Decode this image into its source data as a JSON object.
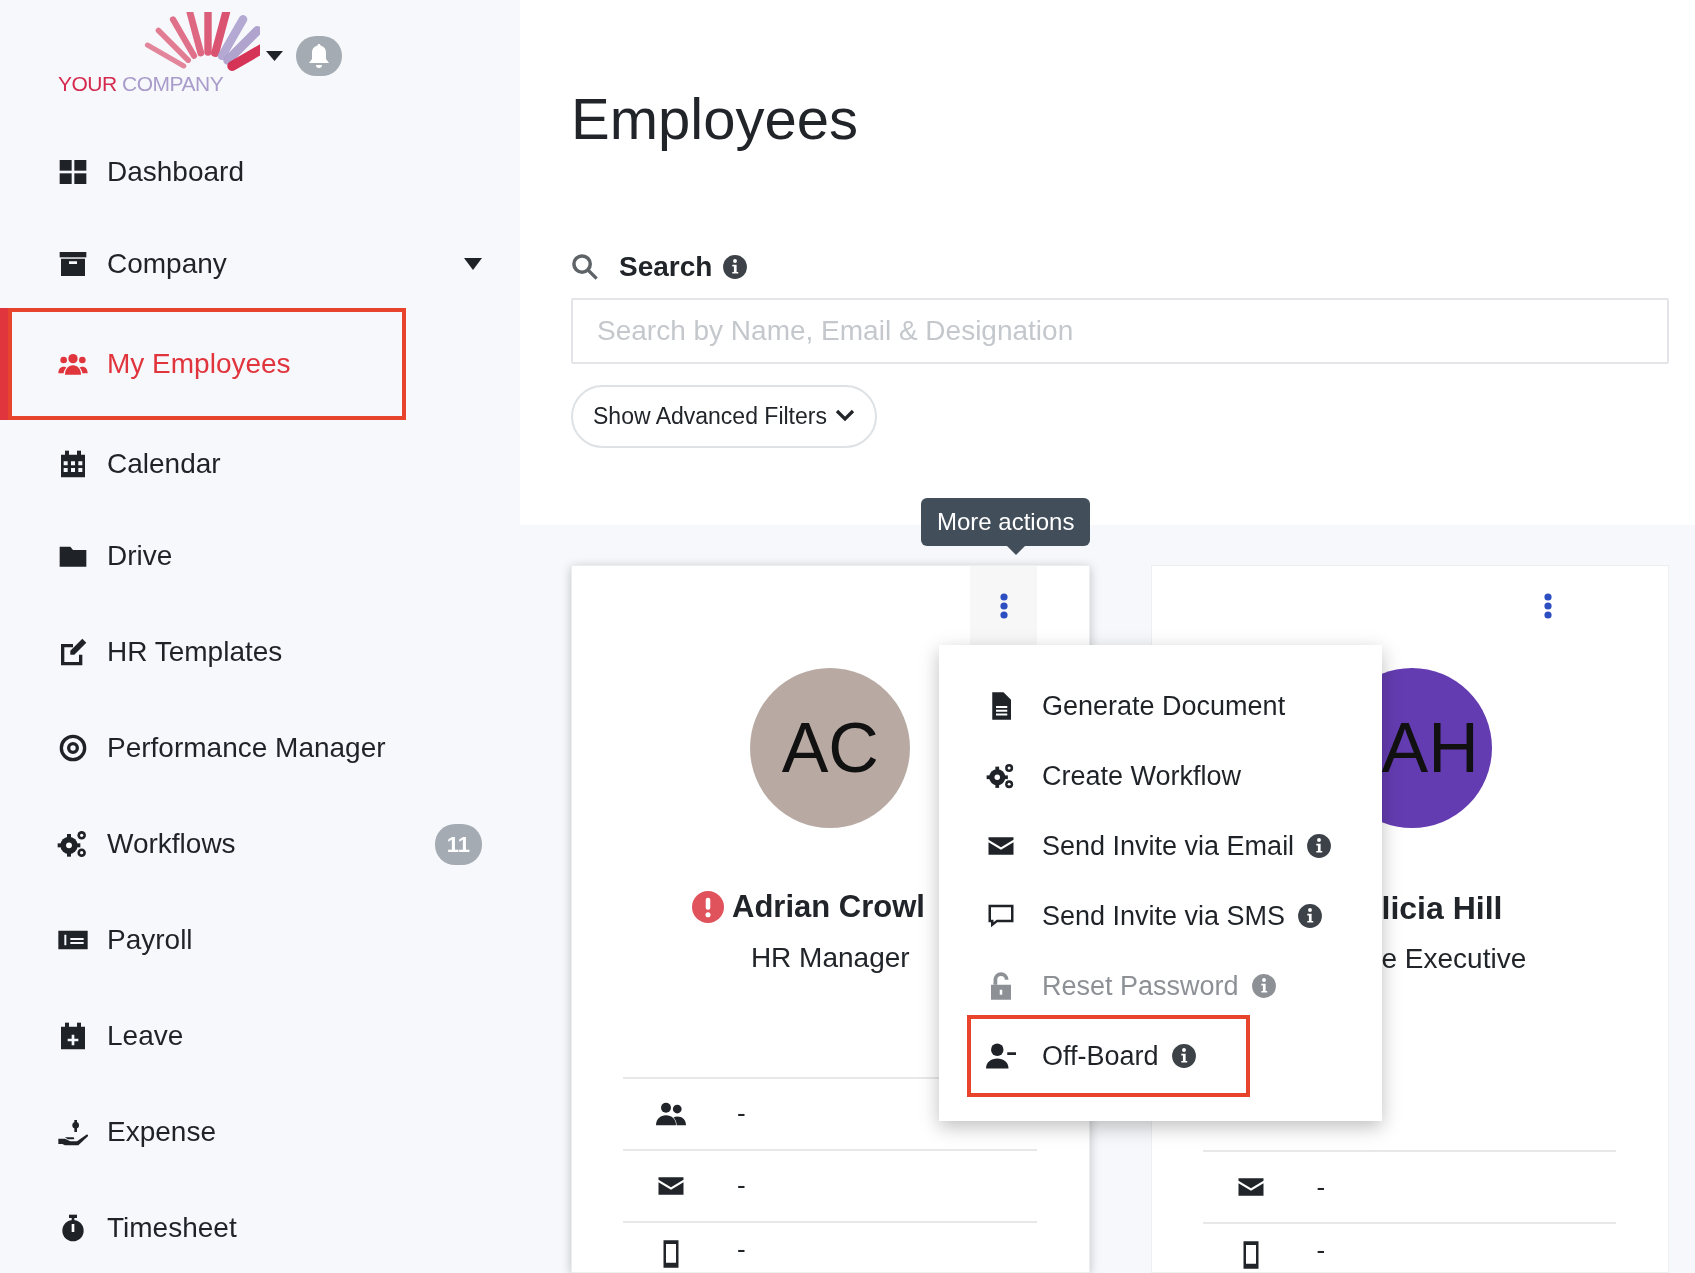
{
  "logo": {
    "word_1": "YOUR",
    "word_2": "COMPANY"
  },
  "sidebar": {
    "items": [
      {
        "label": "Dashboard",
        "kind": "link",
        "selected": false,
        "highlighted": false
      },
      {
        "label": "Company",
        "kind": "group",
        "selected": false,
        "highlighted": false
      },
      {
        "label": "My Employees",
        "kind": "link",
        "selected": true,
        "highlighted": true
      },
      {
        "label": "Calendar",
        "kind": "link",
        "selected": false,
        "highlighted": false
      },
      {
        "label": "Drive",
        "kind": "link",
        "selected": false,
        "highlighted": false
      },
      {
        "label": "HR Templates",
        "kind": "link",
        "selected": false,
        "highlighted": false
      },
      {
        "label": "Performance Manager",
        "kind": "link",
        "selected": false,
        "highlighted": false
      },
      {
        "label": "Workflows",
        "kind": "link",
        "selected": false,
        "highlighted": false,
        "badge": "11"
      },
      {
        "label": "Payroll",
        "kind": "link",
        "selected": false,
        "highlighted": false
      },
      {
        "label": "Leave",
        "kind": "link",
        "selected": false,
        "highlighted": false
      },
      {
        "label": "Expense",
        "kind": "link",
        "selected": false,
        "highlighted": false
      },
      {
        "label": "Timesheet",
        "kind": "link",
        "selected": false,
        "highlighted": false
      }
    ]
  },
  "page": {
    "title": "Employees"
  },
  "search": {
    "label": "Search",
    "placeholder": "Search by Name, Email & Designation"
  },
  "filters_button": "Show Advanced Filters",
  "tooltip": "More actions",
  "cards": [
    {
      "initials": "AC",
      "name": "Adrian Crowl",
      "designation": "HR Manager",
      "color": "#b8aaa3",
      "alert": true,
      "rows": [
        {
          "kind": "team",
          "value": "-"
        },
        {
          "kind": "email",
          "value": "-"
        },
        {
          "kind": "phone",
          "value": "-"
        }
      ]
    },
    {
      "initials": "AH",
      "name": "licia Hill",
      "designation": "e Executive",
      "color": "#643cb1",
      "alert": false,
      "rows": [
        {
          "kind": "email",
          "value": "-"
        },
        {
          "kind": "phone",
          "value": "-"
        }
      ]
    }
  ],
  "menu": {
    "items": [
      {
        "label": "Generate Document",
        "info": false,
        "disabled": false,
        "highlighted": false
      },
      {
        "label": "Create Workflow",
        "info": false,
        "disabled": false,
        "highlighted": false
      },
      {
        "label": "Send Invite via Email",
        "info": true,
        "disabled": false,
        "highlighted": false
      },
      {
        "label": "Send Invite via SMS",
        "info": true,
        "disabled": false,
        "highlighted": false
      },
      {
        "label": "Reset Password",
        "info": true,
        "disabled": true,
        "highlighted": false
      },
      {
        "label": "Off-Board",
        "info": true,
        "disabled": false,
        "highlighted": true
      }
    ]
  }
}
